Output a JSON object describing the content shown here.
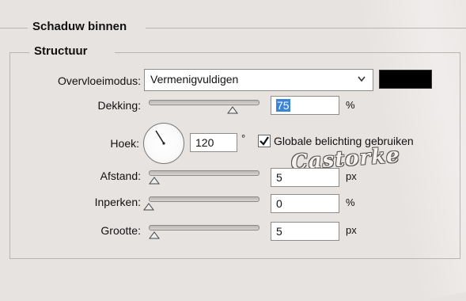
{
  "group": {
    "title": "Schaduw binnen"
  },
  "subgroup": {
    "title": "Structuur"
  },
  "blend_mode": {
    "label": "Overvloeimodus:",
    "value": "Vermenigvuldigen",
    "swatch_color": "#000000"
  },
  "opacity": {
    "label": "Dekking:",
    "value": "75",
    "unit": "%",
    "slider_fraction": 0.75
  },
  "angle": {
    "label": "Hoek:",
    "value": "120",
    "unit": "°",
    "global_light_label": "Globale belichting gebruiken",
    "global_light_checked": true
  },
  "distance": {
    "label": "Afstand:",
    "value": "5",
    "unit": "px",
    "slider_fraction": 0.02
  },
  "choke": {
    "label": "Inperken:",
    "value": "0",
    "unit": "%",
    "slider_fraction": 0.0
  },
  "size": {
    "label": "Grootte:",
    "value": "5",
    "unit": "px",
    "slider_fraction": 0.02
  },
  "watermark": {
    "text": "Castorke"
  }
}
